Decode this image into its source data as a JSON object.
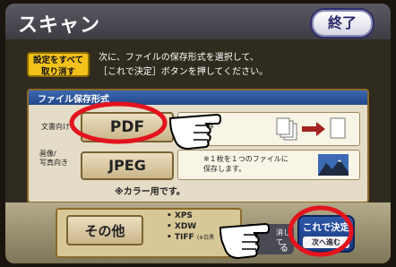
{
  "header": {
    "title": "スキャン",
    "end_label": "終了"
  },
  "reset_button": {
    "line1": "設定をすべて",
    "line2": "取り消す"
  },
  "instruction": {
    "line1": "次に、ファイルの保存形式を選択して、",
    "line2": "［これで決定］ボタンを押してください。"
  },
  "panel": {
    "title": "ファイル保存形式",
    "rows": [
      {
        "label": "文書向け",
        "button": "PDF",
        "note_fragment": "保存"
      },
      {
        "label_line1": "画像/",
        "label_line2": "写真向き",
        "button": "JPEG",
        "note_line1": "※１枚を１つのファイルに",
        "note_line2": "保存します。"
      }
    ],
    "color_note": "※カラー用です。"
  },
  "other": {
    "button": "その他",
    "formats": [
      "• XPS",
      "• XDW",
      "• TIFF"
    ],
    "tiff_note": "(※白黒"
  },
  "next_button": {
    "label": "これで決定",
    "sub_label": "次へ進む"
  },
  "partially_hidden_button": {
    "fragment1": "消して",
    "fragment2": "る"
  },
  "colors": {
    "header_bg": "#4a4a52",
    "panel_title_bar": "#2d56a0",
    "reset_button_bg": "#f2c21a",
    "next_button_bg": "#2b55a5",
    "highlight_circle": "#e3141e"
  },
  "icons": [
    "pointing-hand-icon",
    "document-stack-icon",
    "arrow-right-icon",
    "mountain-photo-icon",
    "pointing-hand-icon"
  ]
}
